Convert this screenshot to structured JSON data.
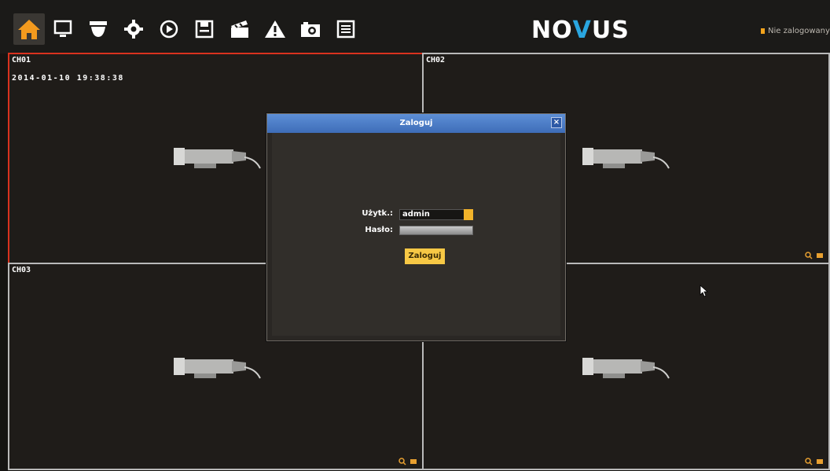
{
  "toolbar": {
    "icons": [
      "home-icon",
      "monitor-icon",
      "ptz-camera-icon",
      "settings-gear-icon",
      "playback-icon",
      "save-icon",
      "clapper-icon",
      "alarm-warning-icon",
      "snapshot-camera-icon",
      "log-list-icon"
    ],
    "brand_prefix": "NO",
    "brand_v": "V",
    "brand_suffix": "US",
    "login_status": "Nie zalogowany"
  },
  "channels": [
    {
      "label": "CH01",
      "timestamp": "2014-01-10 19:38:38",
      "selected": true
    },
    {
      "label": "CH02"
    },
    {
      "label": "CH03"
    },
    {
      "label": ""
    }
  ],
  "dialog": {
    "title": "Zaloguj",
    "close": "×",
    "user_label": "Użytk.:",
    "user_value": "admin",
    "password_label": "Hasło:",
    "password_value": "",
    "login_button": "Zaloguj"
  },
  "colors": {
    "accent": "#f7c845",
    "selected_border": "#d9321e",
    "dialog_title": "#4a7cc8",
    "brand_v": "#2aa6e0"
  }
}
